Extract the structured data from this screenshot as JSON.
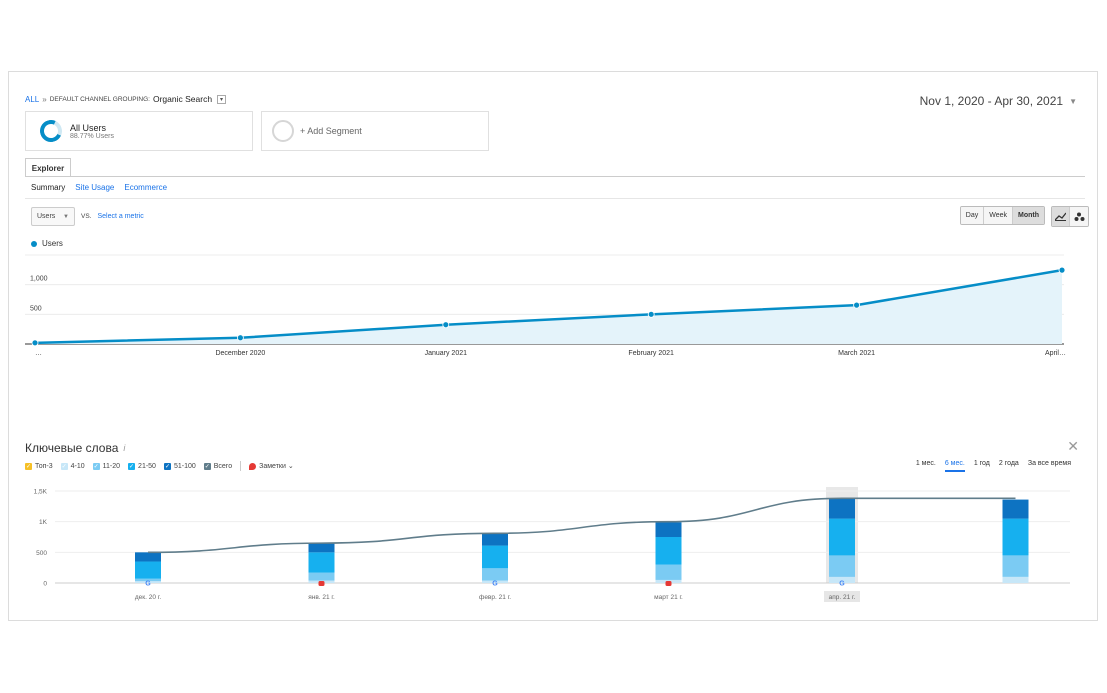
{
  "header": {
    "breadcrumb_all": "ALL",
    "breadcrumb_sep": "»",
    "breadcrumb_group": "DEFAULT CHANNEL GROUPING:",
    "breadcrumb_value": "Organic Search",
    "date_range": "Nov 1, 2020 - Apr 30, 2021"
  },
  "segments": {
    "all_users_title": "All Users",
    "all_users_sub": "88.77% Users",
    "add_segment": "+ Add Segment"
  },
  "tabs": {
    "explorer": "Explorer"
  },
  "subtabs": [
    "Summary",
    "Site Usage",
    "Ecommerce"
  ],
  "metric_row": {
    "select": "Users",
    "vs": "VS.",
    "select_metric": "Select a metric"
  },
  "period_buttons": [
    "Day",
    "Week",
    "Month"
  ],
  "chart_type_icons": [
    "line-chart-icon",
    "motion-chart-icon"
  ],
  "accent_color": "#058dc7",
  "chart_data": [
    {
      "type": "area",
      "series": [
        {
          "name": "Users",
          "values": [
            20,
            105,
            325,
            500,
            655,
            1245
          ]
        }
      ],
      "x": [
        "…",
        "December 2020",
        "January 2021",
        "February 2021",
        "March 2021",
        "April…"
      ],
      "y_ticks": [
        "500",
        "1,000",
        "1,500"
      ],
      "ylim": [
        0,
        1500
      ],
      "grid": true,
      "legend": "top-left"
    },
    {
      "type": "bar",
      "title": "Ключевые слова",
      "categories": [
        "дек. 20 г.",
        "янв. 21 г.",
        "февр. 21 г.",
        "март 21 г.",
        "апр. 21 г.",
        ""
      ],
      "series": [
        {
          "name": "Топ-3",
          "color": "#f6c026",
          "values": [
            0,
            0,
            0,
            0,
            0,
            0
          ]
        },
        {
          "name": "4-10",
          "color": "#c7e7f8",
          "values": [
            30,
            40,
            40,
            50,
            100,
            100
          ]
        },
        {
          "name": "11-20",
          "color": "#7bcbf3",
          "values": [
            40,
            130,
            200,
            250,
            350,
            350
          ]
        },
        {
          "name": "21-50",
          "color": "#16b0ef",
          "values": [
            280,
            330,
            370,
            450,
            600,
            600
          ]
        },
        {
          "name": "51-100",
          "color": "#0d73c2",
          "values": [
            150,
            150,
            200,
            240,
            330,
            310
          ]
        }
      ],
      "total": {
        "name": "Всего",
        "color": "#607d8b",
        "values": [
          500,
          650,
          810,
          1000,
          1380,
          1380
        ]
      },
      "notes_label": "Заметки",
      "y_ticks": [
        "0",
        "500",
        "1K",
        "1,5K"
      ],
      "ylim": [
        0,
        1500
      ],
      "highlighted_category": "апр. 21 г.",
      "range_tabs": [
        "1 мес.",
        "6 мес.",
        "1 год",
        "2 года",
        "За все время"
      ],
      "active_range": "6 мес.",
      "markers": [
        "google-icon",
        "note-icon",
        "google-icon",
        "note-icon",
        "google-icon",
        ""
      ]
    }
  ]
}
